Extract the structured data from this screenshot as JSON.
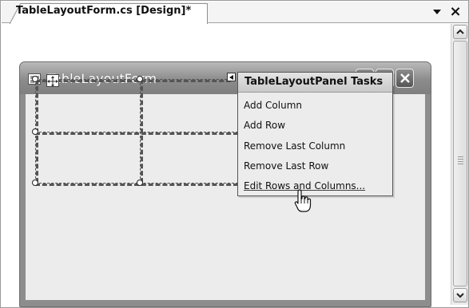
{
  "document_tab": {
    "title": "TableLayoutForm.cs [Design]*"
  },
  "form": {
    "title": "TableLayoutForm"
  },
  "smart_tag_panel": {
    "title": "TableLayoutPanel Tasks",
    "items": [
      "Add Column",
      "Add Row",
      "Remove Last Column",
      "Remove Last Row",
      "Edit Rows and Columns..."
    ]
  },
  "icons": {
    "tab_dropdown": "chevron-down-icon",
    "tab_close": "close-icon",
    "form_icon": "window-form-icon",
    "minimize": "minimize-icon",
    "maximize": "maximize-icon",
    "close": "close-icon",
    "move": "move-arrows-icon",
    "smart_tag": "chevron-left-icon",
    "scroll_up": "chevron-up-icon",
    "scroll_down": "chevron-down-icon",
    "cursor": "hand-pointer-icon"
  }
}
